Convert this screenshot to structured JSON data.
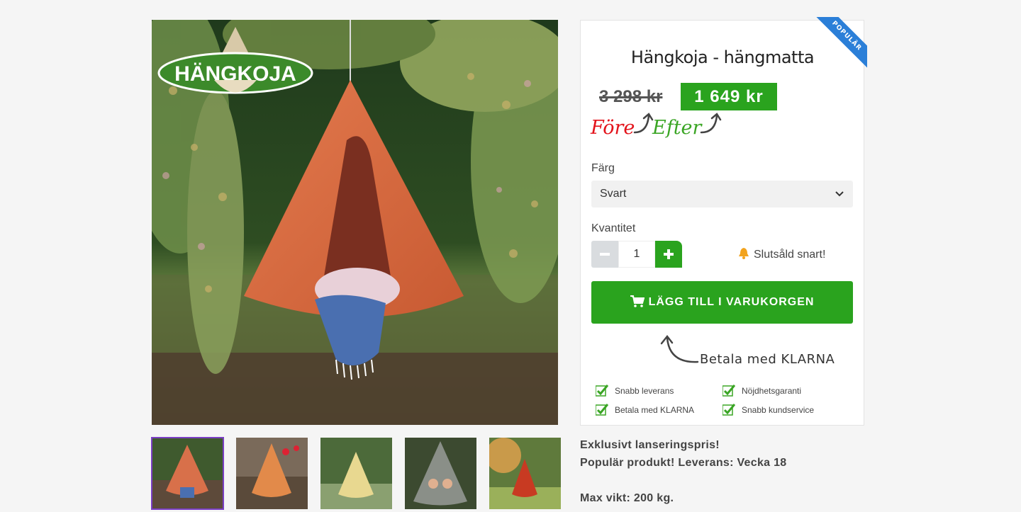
{
  "gallery": {
    "logo_text": "HÄNGKOJA",
    "thumbnails": [
      {
        "name": "thumb-1"
      },
      {
        "name": "thumb-2"
      },
      {
        "name": "thumb-3"
      },
      {
        "name": "thumb-4"
      },
      {
        "name": "thumb-5"
      }
    ]
  },
  "product": {
    "badge": "POPULÄR",
    "title": "Hängkoja - hängmatta",
    "old_price": "3 298 kr",
    "new_price": "1 649 kr",
    "before_label": "Före",
    "after_label": "Efter",
    "color_label": "Färg",
    "color_value": "Svart",
    "quantity_label": "Kvantitet",
    "quantity_value": "1",
    "stock_note": "Slutsåld snart!",
    "add_to_cart": "LÄGG TILL I VARUKORGEN",
    "klarna_note": "Betala med KLARNA",
    "usps": [
      "Snabb leverans",
      "Nöjdhetsgaranti",
      "Betala med KLARNA",
      "Snabb kundservice"
    ]
  },
  "description": {
    "line1": "Exklusivt lanseringspris!",
    "line2": "Populär produkt! Leverans: Vecka 18",
    "line3": "Max vikt: 200 kg."
  },
  "colors": {
    "accent_green": "#2aa31e",
    "price_red": "#e3131b",
    "ribbon_blue": "#2b7fd8",
    "thumb_active": "#7b3fc4"
  },
  "icons": [
    "cart-icon",
    "bell-icon",
    "check-icon",
    "chevron-down-icon",
    "minus-icon",
    "plus-icon"
  ]
}
